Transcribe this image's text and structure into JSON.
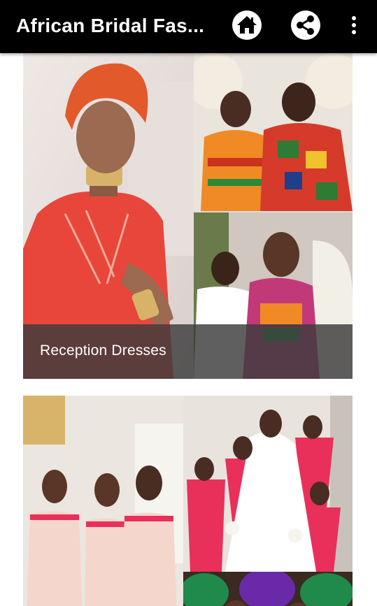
{
  "app_bar": {
    "title": "African Bridal Fas...",
    "home_icon": "home-icon",
    "share_icon": "share-icon",
    "overflow_icon": "more-vert-icon",
    "background": "#000000",
    "icon_color": "#ffffff"
  },
  "cards": [
    {
      "caption": "Reception Dresses"
    },
    {
      "caption": ""
    }
  ],
  "colors": {
    "caption_overlay": "#3c3c3c",
    "accent_red": "#e8463a",
    "kente_orange": "#f08a24",
    "bridesmaid_pink": "#e8305a"
  }
}
